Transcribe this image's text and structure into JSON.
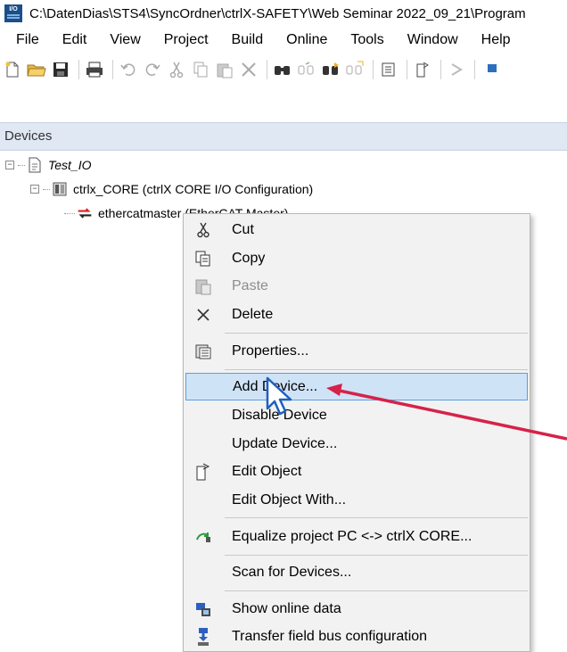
{
  "window": {
    "title": "C:\\DatenDias\\STS4\\SyncOrdner\\ctrlX-SAFETY\\Web Seminar 2022_09_21\\Program",
    "app_icon_text": "I/O"
  },
  "menubar": {
    "items": [
      "File",
      "Edit",
      "View",
      "Project",
      "Build",
      "Online",
      "Tools",
      "Window",
      "Help"
    ]
  },
  "toolbar": {
    "icons": [
      "new-icon",
      "open-icon",
      "save-icon",
      "print-icon",
      "undo-icon",
      "redo-icon",
      "cut-icon",
      "copy-icon",
      "paste-icon",
      "delete-icon",
      "find-icon",
      "find-replace-icon",
      "find-next-icon",
      "replace-icon",
      "properties-icon",
      "edit-object-icon",
      "download-icon"
    ]
  },
  "devices_panel": {
    "title": "Devices",
    "tree": [
      {
        "label": "Test_IO",
        "icon": "project-icon",
        "expanded": true,
        "level": 0
      },
      {
        "label": "ctrlx_CORE (ctrlX CORE I/O Configuration)",
        "icon": "plc-icon",
        "expanded": true,
        "level": 1
      },
      {
        "label": "ethercatmaster (EtherCAT Master)",
        "icon": "ethercat-master-icon",
        "level": 2,
        "selected": true
      }
    ]
  },
  "context_menu": {
    "items": [
      {
        "label": "Cut",
        "icon": "cut-icon",
        "enabled": true
      },
      {
        "label": "Copy",
        "icon": "copy-icon",
        "enabled": true
      },
      {
        "label": "Paste",
        "icon": "paste-icon",
        "enabled": false
      },
      {
        "label": "Delete",
        "icon": "delete-icon",
        "enabled": true
      },
      {
        "label": "Properties...",
        "icon": "properties-icon",
        "enabled": true
      },
      {
        "label": "Add Device...",
        "icon": "",
        "enabled": true,
        "highlighted": true
      },
      {
        "label": "Disable Device",
        "icon": "",
        "enabled": true
      },
      {
        "label": "Update Device...",
        "icon": "",
        "enabled": true
      },
      {
        "label": "Edit Object",
        "icon": "edit-object-icon",
        "enabled": true
      },
      {
        "label": "Edit Object With...",
        "icon": "",
        "enabled": true
      },
      {
        "label": "Equalize project PC <-> ctrlX CORE...",
        "icon": "equalize-icon",
        "enabled": true
      },
      {
        "label": "Scan for Devices...",
        "icon": "",
        "enabled": true
      },
      {
        "label": "Show online data",
        "icon": "online-data-icon",
        "enabled": true
      },
      {
        "label": "Transfer field bus configuration",
        "icon": "transfer-icon",
        "enabled": true
      }
    ]
  },
  "colors": {
    "highlight_bg": "#cfe3f7",
    "highlight_border": "#5a9fdd",
    "annotation_arrow": "#d6224a",
    "panel_header": "#dfe8f3"
  }
}
